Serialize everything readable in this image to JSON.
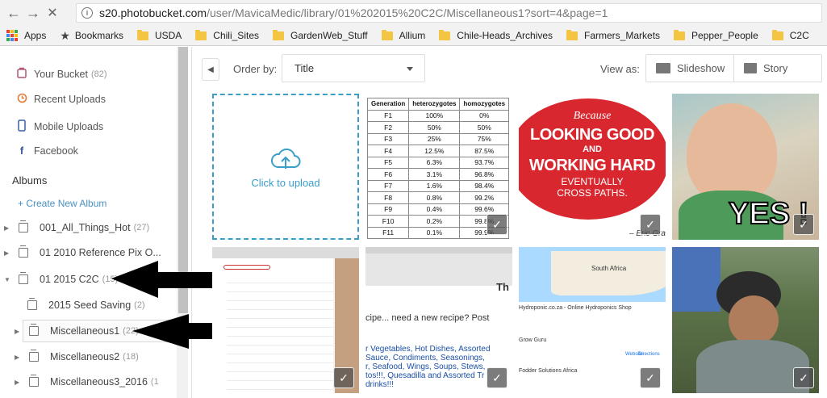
{
  "browser": {
    "url_host": "s20.photobucket.com",
    "url_path": "/user/MavicaMedic/library/01%202015%20C2C/Miscellaneous1?sort=4&page=1",
    "bookmarks": [
      "Apps",
      "Bookmarks",
      "USDA",
      "Chili_Sites",
      "GardenWeb_Stuff",
      "Allium",
      "Chile-Heads_Archives",
      "Farmers_Markets",
      "Pepper_People",
      "C2C"
    ]
  },
  "sidebar": {
    "items": [
      {
        "label": "Your Bucket",
        "count": "(82)",
        "icon": "bucket-icon"
      },
      {
        "label": "Recent Uploads",
        "icon": "clock-icon"
      },
      {
        "label": "Mobile Uploads",
        "icon": "phone-icon"
      },
      {
        "label": "Facebook",
        "icon": "facebook-icon"
      }
    ],
    "albums_heading": "Albums",
    "create_album": "+ Create New Album",
    "albums": [
      {
        "label": "001_All_Things_Hot",
        "count": "(27)"
      },
      {
        "label": "01 2010 Reference Pix O...",
        "count": ""
      },
      {
        "label": "01 2015 C2C",
        "count": "(15)"
      },
      {
        "label": "2015 Seed Saving",
        "count": "(2)"
      },
      {
        "label": "Miscellaneous1",
        "count": "(22)"
      },
      {
        "label": "Miscellaneous2",
        "count": "(18)"
      },
      {
        "label": "Miscellaneous3_2016",
        "count": "(1"
      }
    ]
  },
  "toolbar": {
    "order_label": "Order by:",
    "order_value": "Title",
    "view_label": "View as:",
    "slideshow": "Slideshow",
    "story": "Story"
  },
  "upload_tile": {
    "label": "Click to upload"
  },
  "genetics_table": {
    "headers": [
      "Generation",
      "heterozygotes",
      "homozygotes"
    ],
    "rows": [
      [
        "F1",
        "100%",
        "0%"
      ],
      [
        "F2",
        "50%",
        "50%"
      ],
      [
        "F3",
        "25%",
        "75%"
      ],
      [
        "F4",
        "12.5%",
        "87.5%"
      ],
      [
        "F5",
        "6.3%",
        "93.7%"
      ],
      [
        "F6",
        "3.1%",
        "96.8%"
      ],
      [
        "F7",
        "1.6%",
        "98.4%"
      ],
      [
        "F8",
        "0.8%",
        "99.2%"
      ],
      [
        "F9",
        "0.4%",
        "99.6%"
      ],
      [
        "F10",
        "0.2%",
        "99.8%"
      ],
      [
        "F11",
        "0.1%",
        "99.9%"
      ]
    ]
  },
  "meme_tile": {
    "line1": "Because",
    "line2": "LOOKING GOOD",
    "line3": "AND",
    "line4": "WORKING HARD",
    "line5": "EVENTUALLY",
    "line6": "CROSS PATHS.",
    "credit": "– Eric Gra"
  },
  "baby_tile": {
    "text": "YES !"
  },
  "recipe_tile": {
    "line1": "cipe... need a new recipe? Post",
    "line2": "r Vegetables, Hot Dishes, Assorted",
    "line3": "Sauce, Condiments, Seasonings,",
    "line4": "r, Seafood, Wings, Soups, Stews,",
    "line5": "tos!!!, Quesadilla and Assorted Tr",
    "line6": "drinks!!!",
    "heading": "Th"
  },
  "map_tile": {
    "region": "South Africa",
    "shop": "Hydroponic.co.za - Online Hydroponics Shop",
    "shop2": "Grow Guru",
    "shop3": "Fodder Solutions Africa",
    "website": "Website",
    "directions": "Directions"
  },
  "colors": {
    "accent": "#3a9ec9",
    "link": "#4a90c2",
    "meme_red": "#d8272e"
  }
}
